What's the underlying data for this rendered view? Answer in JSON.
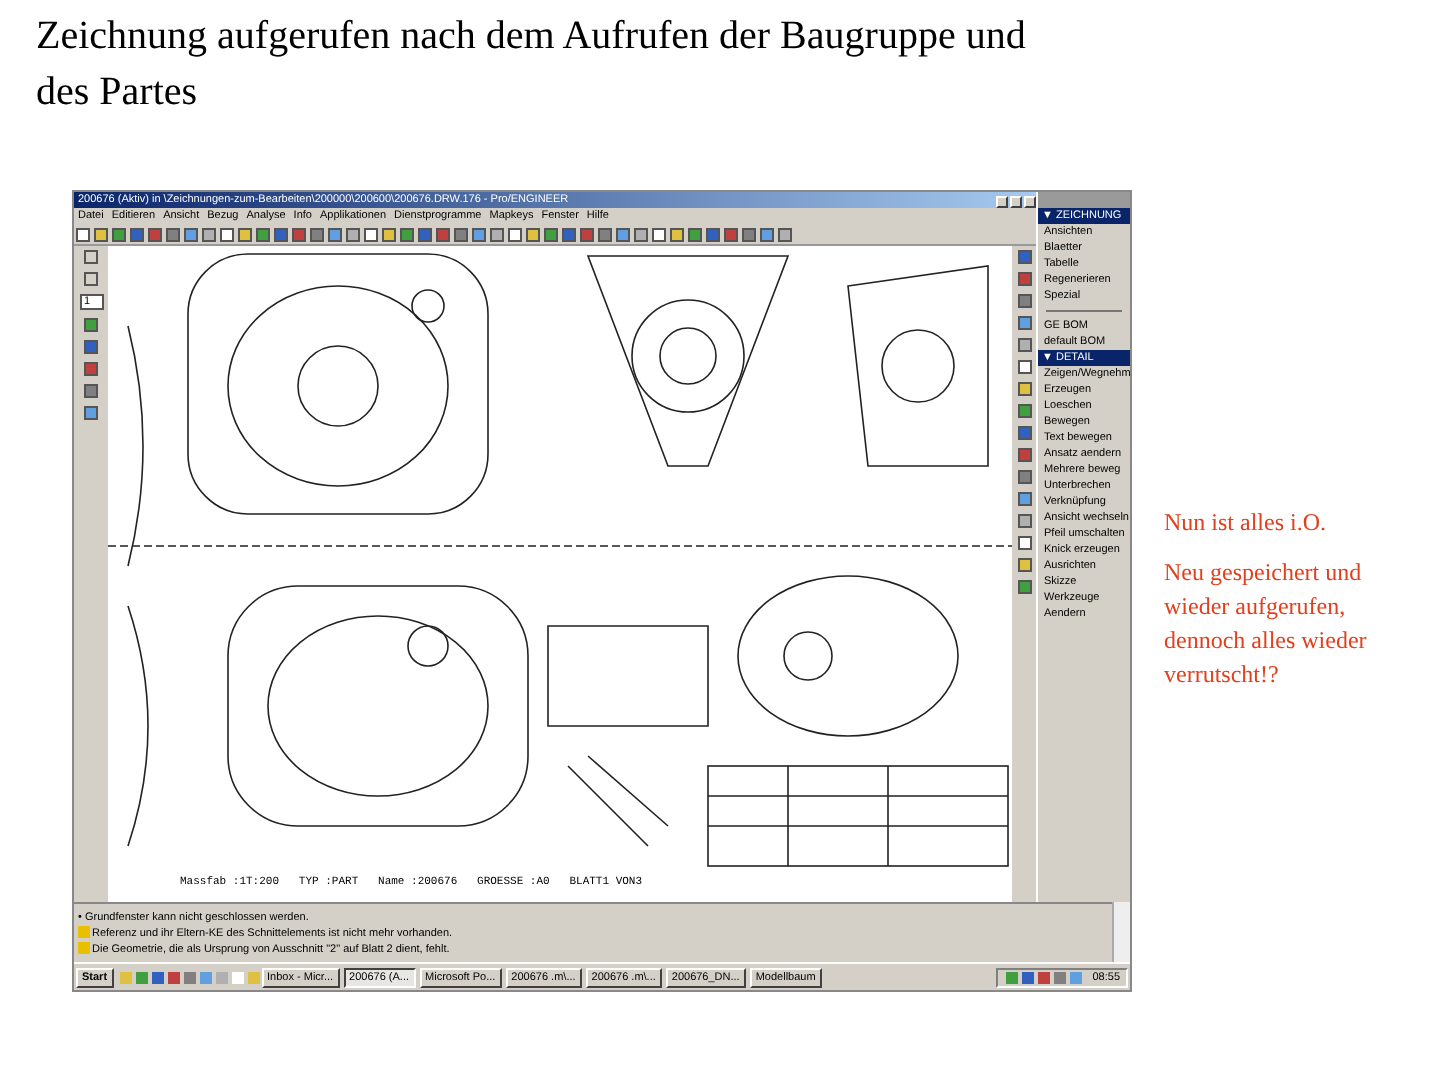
{
  "slide": {
    "title": "Zeichnung aufgerufen nach dem Aufrufen der Baugruppe und des Partes",
    "notes": [
      "Nun ist alles i.O.",
      "Neu gespeichert und wieder aufgerufen, dennoch alles wieder verrutscht!?"
    ]
  },
  "screenshot": {
    "window": {
      "title": "200676 (Aktiv) in \\Zeichnungen-zum-Bearbeiten\\200000\\200600\\200676.DRW.176 - Pro/ENGINEER"
    },
    "menu": [
      "Datei",
      "Editieren",
      "Ansicht",
      "Bezug",
      "Analyse",
      "Info",
      "Applikationen",
      "Dienstprogramme",
      "Mapkeys",
      "Fenster",
      "Hilfe"
    ],
    "sheet_field": {
      "value": "1"
    },
    "drawing": {
      "footer": "Massfab :1T:200   TYP :PART   Name :200676   GROESSE :A0   BLATT1 VON3"
    },
    "menu_panel": [
      {
        "title": "▼ ZEICHNUNG",
        "groups": [
          [
            "Ansichten",
            "Blaetter",
            "Tabelle",
            "Regenerieren",
            "Spezial"
          ],
          [
            "GE BOM",
            "default BOM"
          ]
        ]
      },
      {
        "title": "▼ DETAIL",
        "groups": [
          [
            "Zeigen/Wegnehm",
            "Erzeugen",
            "Loeschen",
            "Bewegen",
            "Text bewegen",
            "Ansatz aendern",
            "Mehrere beweg",
            "Unterbrechen",
            "Verknüpfung",
            "Ansicht wechseln",
            "Pfeil umschalten",
            "Knick erzeugen",
            "Ausrichten",
            "Skizze",
            "Werkzeuge",
            "Aendern"
          ]
        ]
      }
    ],
    "messages": [
      {
        "kind": "info",
        "text": "• Grundfenster kann nicht geschlossen werden."
      },
      {
        "kind": "warning",
        "text": "Referenz und ihr Eltern-KE des Schnittelements ist nicht mehr vorhanden."
      },
      {
        "kind": "warning",
        "text": "Die Geometrie, die als Ursprung von Ausschnitt \"2\" auf Blatt 2 dient, fehlt."
      }
    ],
    "taskbar": {
      "start": "Start",
      "buttons": [
        {
          "label": "Inbox - Micr...",
          "selected": false
        },
        {
          "label": "200676 (A...",
          "selected": true
        },
        {
          "label": "Microsoft Po...",
          "selected": false
        },
        {
          "label": "200676 .m\\...",
          "selected": false
        },
        {
          "label": "200676 .m\\...",
          "selected": false
        },
        {
          "label": "200676_DN...",
          "selected": false
        },
        {
          "label": "Modellbaum",
          "selected": false
        }
      ],
      "clock": "08:55"
    }
  }
}
